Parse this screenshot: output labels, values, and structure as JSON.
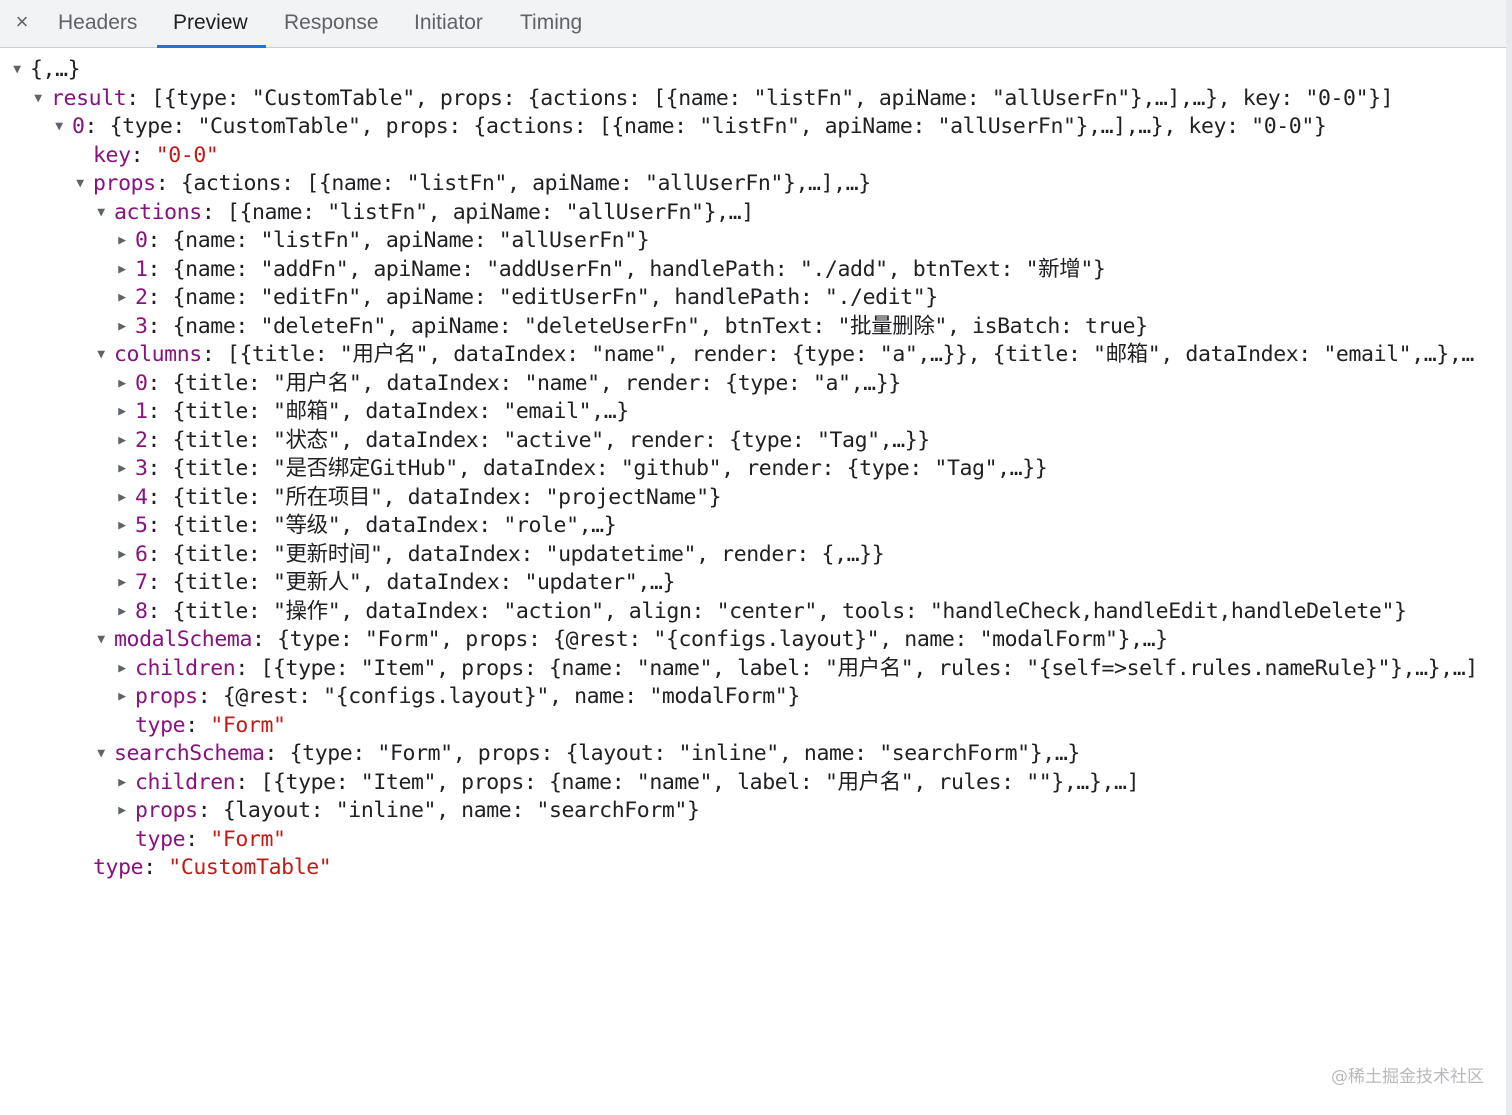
{
  "close_icon": "×",
  "tabs": [
    "Headers",
    "Preview",
    "Response",
    "Initiator",
    "Timing"
  ],
  "active_tab": "Preview",
  "tree": [
    {
      "indent": 0,
      "arrow": "down",
      "key": "",
      "text": "{,…}"
    },
    {
      "indent": 1,
      "arrow": "down",
      "key": "result",
      "text": "[{type: \"CustomTable\", props: {actions: [{name: \"listFn\", apiName: \"allUserFn\"},…],…}, key: \"0-0\"}]"
    },
    {
      "indent": 2,
      "arrow": "down",
      "key": "0",
      "text": "{type: \"CustomTable\", props: {actions: [{name: \"listFn\", apiName: \"allUserFn\"},…],…}, key: \"0-0\"}"
    },
    {
      "indent": 3,
      "arrow": "none",
      "key": "key",
      "value": "\"0-0\""
    },
    {
      "indent": 3,
      "arrow": "down",
      "key": "props",
      "text": "{actions: [{name: \"listFn\", apiName: \"allUserFn\"},…],…}"
    },
    {
      "indent": 4,
      "arrow": "down",
      "key": "actions",
      "text": "[{name: \"listFn\", apiName: \"allUserFn\"},…]"
    },
    {
      "indent": 5,
      "arrow": "right",
      "key": "0",
      "text": "{name: \"listFn\", apiName: \"allUserFn\"}"
    },
    {
      "indent": 5,
      "arrow": "right",
      "key": "1",
      "text": "{name: \"addFn\", apiName: \"addUserFn\", handlePath: \"./add\", btnText: \"新增\"}"
    },
    {
      "indent": 5,
      "arrow": "right",
      "key": "2",
      "text": "{name: \"editFn\", apiName: \"editUserFn\", handlePath: \"./edit\"}"
    },
    {
      "indent": 5,
      "arrow": "right",
      "key": "3",
      "text": "{name: \"deleteFn\", apiName: \"deleteUserFn\", btnText: \"批量删除\", isBatch: true}"
    },
    {
      "indent": 4,
      "arrow": "down",
      "key": "columns",
      "text": "[{title: \"用户名\", dataIndex: \"name\", render: {type: \"a\",…}}, {title: \"邮箱\", dataIndex: \"email\",…},…"
    },
    {
      "indent": 5,
      "arrow": "right",
      "key": "0",
      "text": "{title: \"用户名\", dataIndex: \"name\", render: {type: \"a\",…}}"
    },
    {
      "indent": 5,
      "arrow": "right",
      "key": "1",
      "text": "{title: \"邮箱\", dataIndex: \"email\",…}"
    },
    {
      "indent": 5,
      "arrow": "right",
      "key": "2",
      "text": "{title: \"状态\", dataIndex: \"active\", render: {type: \"Tag\",…}}"
    },
    {
      "indent": 5,
      "arrow": "right",
      "key": "3",
      "text": "{title: \"是否绑定GitHub\", dataIndex: \"github\", render: {type: \"Tag\",…}}"
    },
    {
      "indent": 5,
      "arrow": "right",
      "key": "4",
      "text": "{title: \"所在项目\", dataIndex: \"projectName\"}"
    },
    {
      "indent": 5,
      "arrow": "right",
      "key": "5",
      "text": "{title: \"等级\", dataIndex: \"role\",…}"
    },
    {
      "indent": 5,
      "arrow": "right",
      "key": "6",
      "text": "{title: \"更新时间\", dataIndex: \"updatetime\", render: {,…}}"
    },
    {
      "indent": 5,
      "arrow": "right",
      "key": "7",
      "text": "{title: \"更新人\", dataIndex: \"updater\",…}"
    },
    {
      "indent": 5,
      "arrow": "right",
      "key": "8",
      "text": "{title: \"操作\", dataIndex: \"action\", align: \"center\", tools: \"handleCheck,handleEdit,handleDelete\"}"
    },
    {
      "indent": 4,
      "arrow": "down",
      "key": "modalSchema",
      "text": "{type: \"Form\", props: {@rest: \"{configs.layout}\", name: \"modalForm\"},…}"
    },
    {
      "indent": 5,
      "arrow": "right",
      "key": "children",
      "text": "[{type: \"Item\", props: {name: \"name\", label: \"用户名\", rules: \"{self=>self.rules.nameRule}\"},…},…]"
    },
    {
      "indent": 5,
      "arrow": "right",
      "key": "props",
      "text": "{@rest: \"{configs.layout}\", name: \"modalForm\"}"
    },
    {
      "indent": 5,
      "arrow": "none",
      "key": "type",
      "value": "\"Form\""
    },
    {
      "indent": 4,
      "arrow": "down",
      "key": "searchSchema",
      "text": "{type: \"Form\", props: {layout: \"inline\", name: \"searchForm\"},…}"
    },
    {
      "indent": 5,
      "arrow": "right",
      "key": "children",
      "text": "[{type: \"Item\", props: {name: \"name\", label: \"用户名\", rules: \"\"},…},…]"
    },
    {
      "indent": 5,
      "arrow": "right",
      "key": "props",
      "text": "{layout: \"inline\", name: \"searchForm\"}"
    },
    {
      "indent": 5,
      "arrow": "none",
      "key": "type",
      "value": "\"Form\""
    },
    {
      "indent": 3,
      "arrow": "none",
      "key": "type",
      "value": "\"CustomTable\""
    }
  ],
  "watermark": "@稀土掘金技术社区"
}
